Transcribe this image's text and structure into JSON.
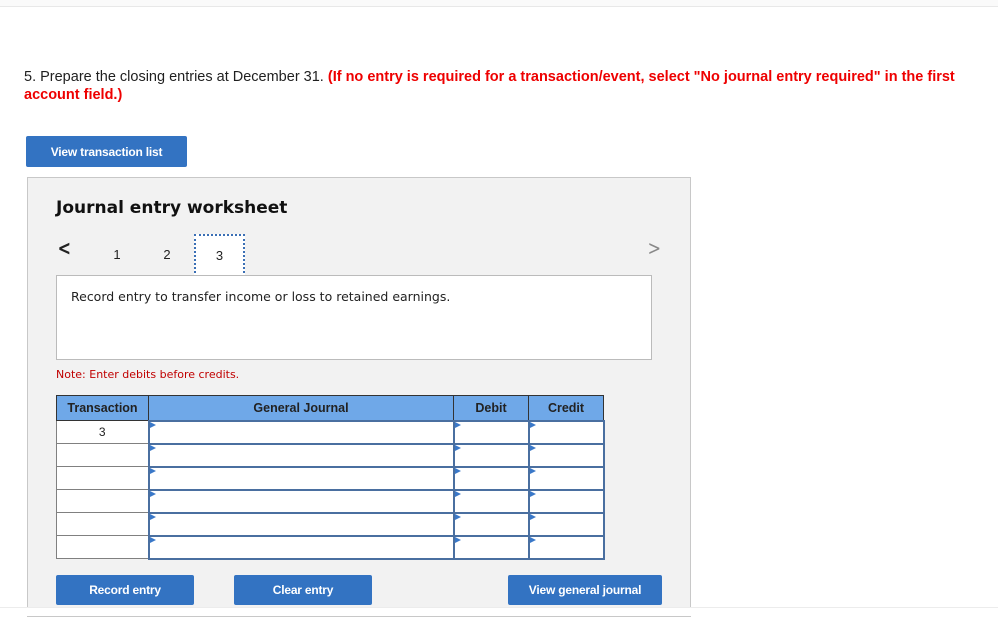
{
  "question": {
    "text": "5. Prepare the closing entries at December 31.",
    "instruction": "(If no entry is required for a transaction/event, select \"No journal entry required\" in the first account field.)"
  },
  "buttons": {
    "view_transaction_list": "View transaction list",
    "record_entry": "Record entry",
    "clear_entry": "Clear entry",
    "view_general_journal": "View general journal"
  },
  "worksheet": {
    "title": "Journal entry worksheet",
    "nav": {
      "prev_icon": "chevron-left-icon",
      "prev": "<",
      "next_icon": "chevron-right-icon",
      "next": ">"
    },
    "pages": [
      "1",
      "2",
      "3"
    ],
    "active_page": "3",
    "description": "Record entry to transfer income or loss to retained earnings.",
    "note": "Note: Enter debits before credits."
  },
  "table": {
    "headers": {
      "transaction": "Transaction",
      "general_journal": "General Journal",
      "debit": "Debit",
      "credit": "Credit"
    },
    "rows": [
      {
        "transaction": "3",
        "account": "",
        "debit": "",
        "credit": ""
      },
      {
        "transaction": "",
        "account": "",
        "debit": "",
        "credit": ""
      },
      {
        "transaction": "",
        "account": "",
        "debit": "",
        "credit": ""
      },
      {
        "transaction": "",
        "account": "",
        "debit": "",
        "credit": ""
      },
      {
        "transaction": "",
        "account": "",
        "debit": "",
        "credit": ""
      },
      {
        "transaction": "",
        "account": "",
        "debit": "",
        "credit": ""
      }
    ]
  },
  "colors": {
    "button_blue": "#3373c2",
    "header_blue": "#6fa8e8",
    "instruction_red": "#ee0000",
    "note_red": "#c00000"
  }
}
